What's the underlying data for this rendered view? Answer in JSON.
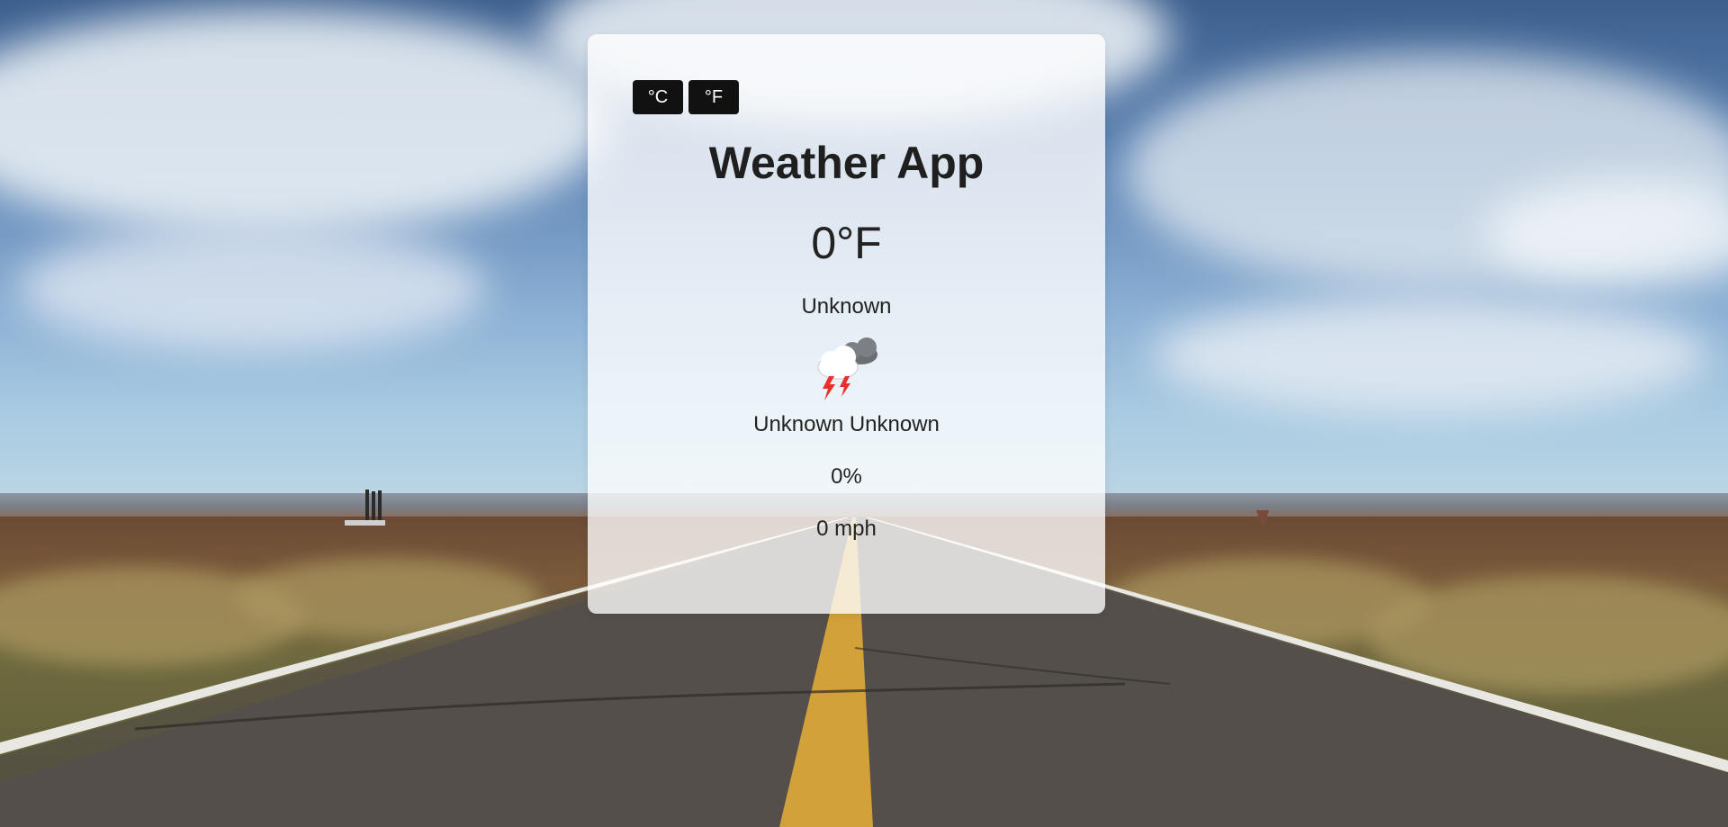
{
  "unit_toggle": {
    "celsius_label": "°C",
    "fahrenheit_label": "°F"
  },
  "app": {
    "title": "Weather App"
  },
  "weather": {
    "temperature": "0°F",
    "condition": "Unknown",
    "icon": "thunderstorm-icon",
    "location": "Unknown Unknown",
    "humidity": "0%",
    "wind_speed": "0 mph"
  },
  "colors": {
    "button_bg": "#111111",
    "button_text": "#ffffff",
    "text": "#222222"
  }
}
